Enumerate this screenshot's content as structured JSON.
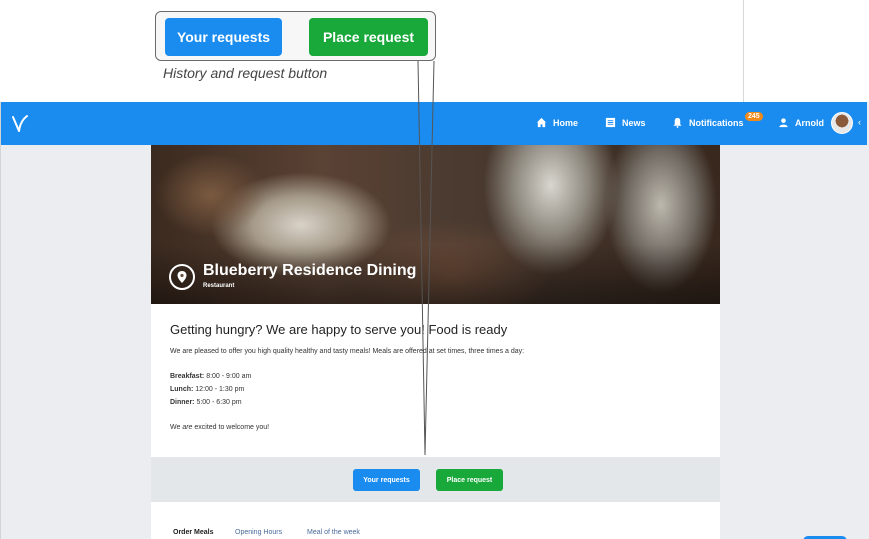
{
  "annotation": {
    "requests_label": "Your requests",
    "place_label": "Place request",
    "caption": "History and request button"
  },
  "nav": {
    "home": "Home",
    "news": "News",
    "notifications": "Notifications",
    "notifications_count": "245",
    "user": "Arnold"
  },
  "hero": {
    "title": "Blueberry Residence Dining",
    "subtitle": "Restaurant"
  },
  "content": {
    "heading": "Getting hungry? We are happy to serve you! Food is ready",
    "intro": "We are pleased to offer you high quality healthy and tasty meals! Meals are offered at set times, three times a day:",
    "meals": [
      {
        "name": "Breakfast:",
        "time": "8:00 - 9:00 am"
      },
      {
        "name": "Lunch:",
        "time": "12:00 - 1:30 pm"
      },
      {
        "name": "Dinner:",
        "time": "5:00 - 6:30 pm"
      }
    ],
    "outro_pre": "We ",
    "outro_em": "are",
    "outro_post": " excited to welcome you!"
  },
  "actions": {
    "requests_label": "Your requests",
    "place_label": "Place request"
  },
  "tabs": [
    "Order Meals",
    "Opening Hours",
    "Meal of the week"
  ],
  "colors": {
    "primary": "#1a8cf0",
    "success": "#19a83a",
    "badge": "#f08a1a"
  }
}
